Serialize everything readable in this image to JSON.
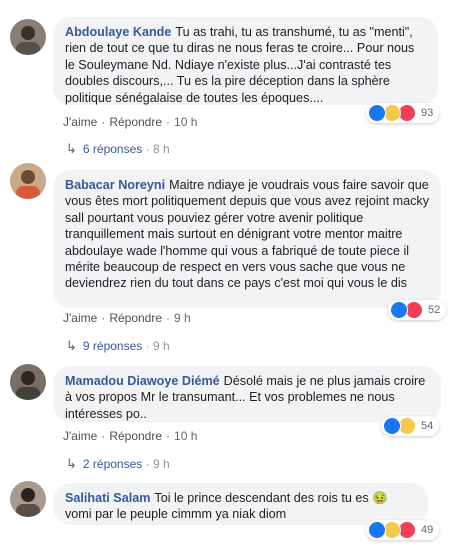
{
  "comments": [
    {
      "author": "Abdoulaye Kande",
      "text": "Tu as trahi, tu as transhumé, tu as \"menti\", rien de tout ce que tu diras ne nous feras te croire... Pour nous le Souleymane Nd. Ndiaye n'existe plus...J'ai contrasté tes doubles discours,... Tu es la pire déception dans la sphère politique sénégalaise de toutes les époques....",
      "reactions_count": "93",
      "like_label": "J'aime",
      "reply_label": "Répondre",
      "time": "10 h",
      "replies_label": "6 réponses",
      "replies_time": "8 h"
    },
    {
      "author": "Babacar Noreyni",
      "text": "Maitre ndiaye je voudrais vous faire savoir que vous êtes mort politiquement depuis que vous avez rejoint macky sall pourtant vous pouviez gérer votre avenir politique tranquillement mais surtout en dénigrant votre mentor maitre abdoulaye wade l'homme qui vous a fabriqué de toute piece il mérite beaucoup de respect en vers vous sache que vous ne deviendrez rien du tout dans ce pays c'est moi qui vous le dis",
      "reactions_count": "52",
      "like_label": "J'aime",
      "reply_label": "Répondre",
      "time": "9 h",
      "replies_label": "9 réponses",
      "replies_time": "9 h"
    },
    {
      "author": "Mamadou Diawoye Diémé",
      "text": "Désolé mais je ne plus jamais croire à vos propos Mr le transumant... Et vos problemes ne nous intéresses po..",
      "reactions_count": "54",
      "like_label": "J'aime",
      "reply_label": "Répondre",
      "time": "10 h",
      "replies_label": "2 réponses",
      "replies_time": "9 h"
    },
    {
      "author": "Salihati Salam",
      "text": "Toi le prince descendant des rois tu es 🤢 vomi par le peuple cimmm ya niak diom",
      "reactions_count": "49"
    }
  ],
  "colors": {
    "author": "#385898",
    "bubble": "#f2f3f5",
    "like": "#1877f2",
    "haha": "#f7c948",
    "love": "#f33e58"
  }
}
